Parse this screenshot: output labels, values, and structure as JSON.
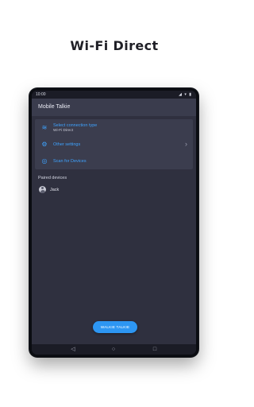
{
  "headline": "Wi-Fi Direct",
  "status_bar": {
    "time": "10:00",
    "icons": "◢ ▾ ▮"
  },
  "app_bar": {
    "title": "Mobile Talkie"
  },
  "menu": {
    "items": [
      {
        "icon": "wifi-icon",
        "glyph": "≋",
        "title": "Select connection type",
        "subtitle": "Wi-Fi Direct"
      },
      {
        "icon": "gear-icon",
        "glyph": "⚙",
        "title": "Other settings",
        "chevron": "›"
      },
      {
        "icon": "broadcast-icon",
        "glyph": "◎",
        "title": "Scan for Devices"
      }
    ]
  },
  "paired": {
    "heading": "Paired devices",
    "devices": [
      {
        "name": "Jack"
      }
    ]
  },
  "fab": {
    "label": "WALKIE TALKIE"
  },
  "nav": {
    "back": "◁",
    "home": "○",
    "recent": "□"
  },
  "colors": {
    "accent": "#3ea3ff",
    "button": "#2d96f3",
    "screen": "#2f303f",
    "card": "#3b3d4e"
  }
}
